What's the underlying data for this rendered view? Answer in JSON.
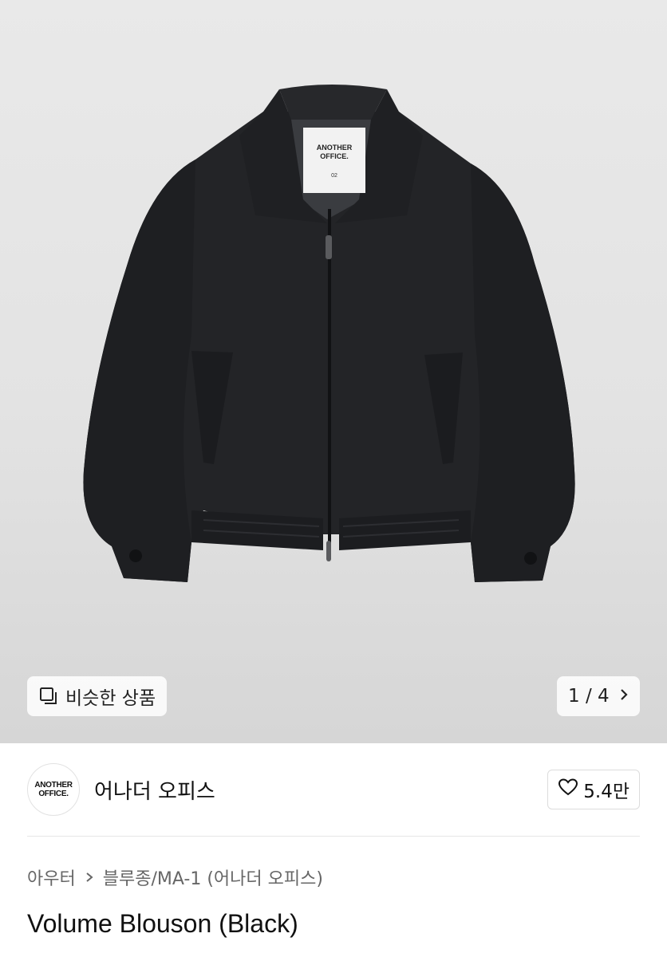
{
  "hero": {
    "similar_label": "비슷한 상품",
    "pager_text": "1 / 4",
    "tag_brand_line1": "ANOTHER",
    "tag_brand_line2": "OFFICE.",
    "tag_size": "02"
  },
  "brand": {
    "logo_line1": "ANOTHER",
    "logo_line2": "OFFICE.",
    "name": "어나더 오피스",
    "likes": "5.4만"
  },
  "breadcrumb": {
    "category": "아우터",
    "subcategory": "블루종/MA-1 (어나더 오피스)"
  },
  "product": {
    "title": "Volume Blouson (Black)"
  },
  "icons": {
    "similar": "stacked-squares-icon",
    "pager": "chevron-right-icon",
    "like": "heart-outline-icon",
    "breadcrumb_sep": "chevron-right-icon"
  },
  "colors": {
    "jacket": "#232427",
    "hero_bg": "#e5e5e5"
  }
}
